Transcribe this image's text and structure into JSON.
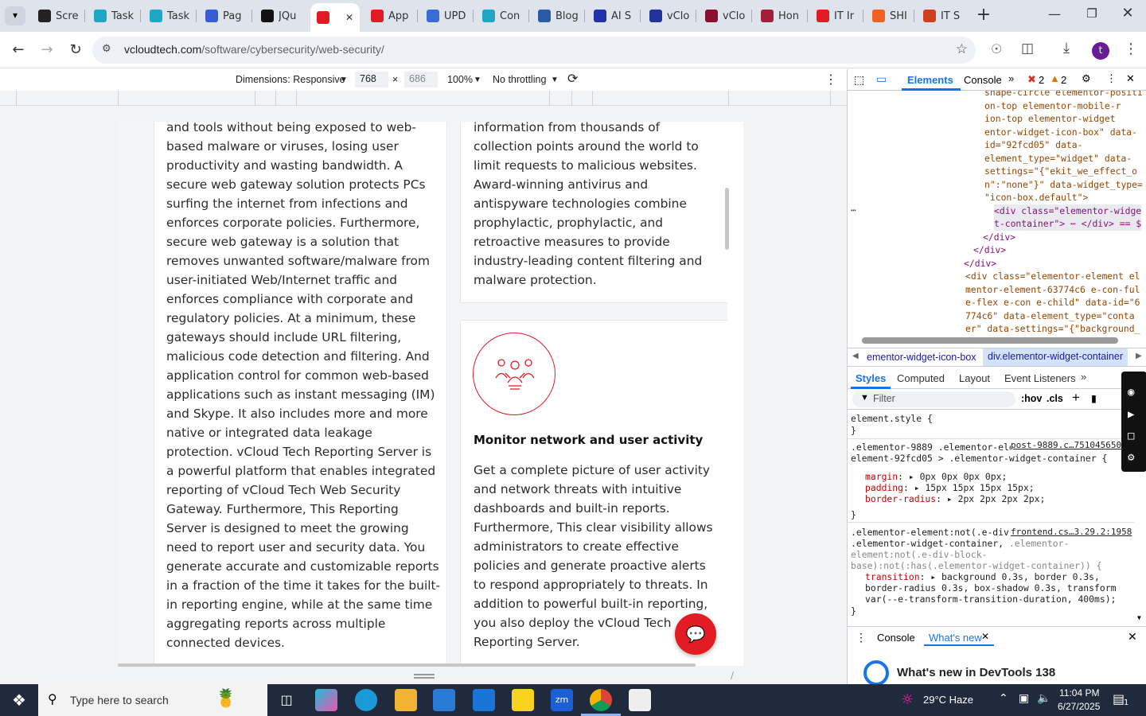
{
  "browser": {
    "tabs": [
      {
        "label": "Scre",
        "color": "#222222"
      },
      {
        "label": "Task",
        "color": "#1ea7c5"
      },
      {
        "label": "Task",
        "color": "#1ea7c5"
      },
      {
        "label": "Pag",
        "color": "#3b5bd6"
      },
      {
        "label": "JQu",
        "color": "#111111"
      },
      {
        "label": "",
        "color": "#e31b23"
      },
      {
        "label": "App",
        "color": "#e31b23"
      },
      {
        "label": "UPD",
        "color": "#3d6bd6"
      },
      {
        "label": "Con",
        "color": "#1ea7c5"
      },
      {
        "label": "Blog",
        "color": "#2a5aa8"
      },
      {
        "label": "AI S",
        "color": "#2233aa"
      },
      {
        "label": "vClo",
        "color": "#223399"
      },
      {
        "label": "vClo",
        "color": "#8a1030"
      },
      {
        "label": "Hon",
        "color": "#a0203a"
      },
      {
        "label": "IT Ir",
        "color": "#e31b23"
      },
      {
        "label": "SHI",
        "color": "#f06020"
      },
      {
        "label": "IT S",
        "color": "#d04020"
      }
    ],
    "url_host": "vcloudtech.com",
    "url_path": "/software/cybersecurity/web-security/",
    "profile_initial": "t"
  },
  "device_toolbar": {
    "dimensions_label": "Dimensions: Responsive",
    "width": "768",
    "times": "×",
    "height": "686",
    "zoom": "100%",
    "throttling": "No throttling"
  },
  "page": {
    "left_text": "and tools without being exposed to web-based malware or viruses, losing user productivity and wasting bandwidth. A secure web gateway solution protects PCs surfing the internet from infections and enforces corporate policies. Furthermore, secure web gateway is a solution that removes unwanted software/malware from user-initiated Web/Internet traffic and enforces compliance with corporate and regulatory policies. At a minimum, these gateways should include URL filtering, malicious code detection and filtering. And application control for common web-based applications such as instant messaging (IM) and Skype. It also includes more and more native or integrated data leakage protection. vCloud Tech Reporting Server is a powerful platform that enables integrated reporting of vCloud Tech Web Security Gateway. Furthermore, This Reporting Server is designed to meet the growing need to report user and security data. You generate accurate and customizable reports in a fraction of the time it takes for the built-in reporting engine, while at the same time aggregating reports across multiple connected devices.",
    "right_top_text": "information from thousands of collection points around the world to limit requests to malicious websites. Award-winning antivirus and antispyware technologies combine prophylactic, prophylactic, and retroactive measures to provide industry-leading content filtering and malware protection.",
    "card_title": "Monitor network and user activity",
    "card_text": "Get a complete picture of user activity and network threats with intuitive dashboards and built-in reports. Furthermore, This clear visibility allows administrators to create effective policies and generate proactive alerts to respond appropriately to threats. In addition to powerful built-in reporting, you also deploy the vCloud Tech Reporting Server.",
    "accent": "#e31b23"
  },
  "devtools": {
    "tabs": [
      "Elements",
      "Console"
    ],
    "errors": "2",
    "warnings": "2",
    "code_lines": [
      "shape-circle elementor-positi",
      "on-top elementor-mobile-r",
      "ion-top elementor-widget",
      "entor-widget-icon-box\" data-",
      "id=\"92fcd05\" data-",
      "element_type=\"widget\" data-",
      "settings=\"{\"ekit_we_effect_o",
      "n\":\"none\"}\" data-widget_type=",
      "\"icon-box.default\">",
      "<div class=\"elementor-widge",
      "t-container\"> ⋯ </div> == $",
      "</div>",
      "</div>",
      "</div>",
      "<div class=\"elementor-element el",
      "mentor-element-63774c6 e-con-ful",
      "e-flex e-con e-child\" data-id=\"6",
      "774c6\" data-element_type=\"conta",
      "er\" data-settings=\"{\"background_"
    ],
    "crumbs": [
      "ementor-widget-icon-box",
      "div.elementor-widget-container"
    ],
    "style_tabs": [
      "Styles",
      "Computed",
      "Layout",
      "Event Listeners"
    ],
    "filter_placeholder": "Filter",
    "hov": ":hov",
    "cls": ".cls",
    "rule1_selector": "element.style {",
    "rule1_close": "}",
    "rule2_selector": ".elementor-9889 .elementor-element.elementor-element-92fcd05 > .elementor-widget-container {",
    "rule2_source": "post-9889.c…751045650",
    "rule2_props": [
      {
        "name": "margin",
        "value": "0px 0px 0px 0px;"
      },
      {
        "name": "padding",
        "value": "15px 15px 15px 15px;"
      },
      {
        "name": "border-radius",
        "value": "2px 2px 2px 2px;"
      }
    ],
    "rule3_selector": ".elementor-element:not(.e-div-block-base) .elementor-widget-container,",
    "rule3_selector2": ".elementor-element:not(.e-div-block-base):not(:has(.elementor-widget-container)) {",
    "rule3_source": "frontend.cs…3.29.2:1958",
    "rule3_prop": "transition",
    "rule3_value": "background 0.3s, border 0.3s, border-radius 0.3s, box-shadow 0.3s, transform var(--e-transform-transition-duration, 400ms);",
    "drawer_tabs": [
      "Console",
      "What's new"
    ],
    "whats_new": "What's new in DevTools 138"
  },
  "taskbar": {
    "search_placeholder": "Type here to search",
    "weather": "29°C  Haze",
    "time": "11:04 PM",
    "date": "6/27/2025",
    "notifications": "1"
  }
}
